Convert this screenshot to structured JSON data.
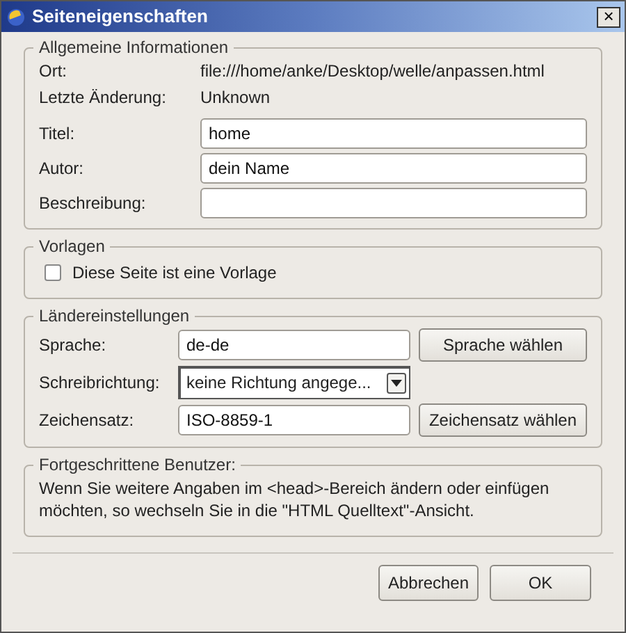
{
  "window": {
    "title": "Seiteneigenschaften",
    "close": "×"
  },
  "general": {
    "legend": "Allgemeine Informationen",
    "info": [
      {
        "label": "Ort:",
        "value": "file:///home/anke/Desktop/welle/anpassen.html"
      },
      {
        "label": "Letzte Änderung:",
        "value": "Unknown"
      }
    ],
    "fields": [
      {
        "label": "Titel:",
        "value": "home"
      },
      {
        "label": "Autor:",
        "value": "dein Name"
      },
      {
        "label": "Beschreibung:"
      }
    ]
  },
  "templates": {
    "legend": "Vorlagen",
    "checkbox": {
      "label": "Diese Seite ist eine Vorlage",
      "checked": false
    }
  },
  "locale": {
    "legend": "Ländereinstellungen",
    "rows": [
      {
        "kind": "input",
        "label": "Sprache:",
        "value": "de-de",
        "button": "Sprache wählen"
      },
      {
        "kind": "select",
        "label": "Schreibrichtung:",
        "value": "keine Richtung angege..."
      },
      {
        "kind": "input",
        "label": "Zeichensatz:",
        "value": "ISO-8859-1",
        "button": "Zeichensatz wählen"
      }
    ]
  },
  "advanced": {
    "legend": "Fortgeschrittene Benutzer:",
    "text": "Wenn Sie weitere Angaben im <head>-Bereich ändern oder einfügen möchten, so wechseln Sie in die \"HTML Quelltext\"-Ansicht."
  },
  "buttons": [
    "Abbrechen",
    "OK"
  ]
}
